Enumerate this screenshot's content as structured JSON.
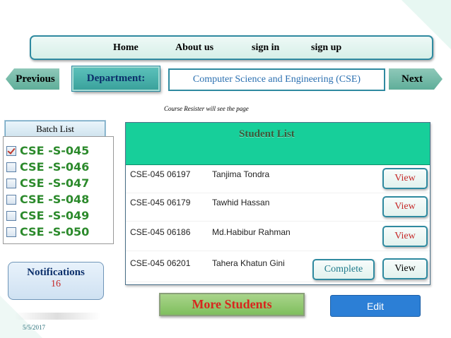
{
  "nav": {
    "home": "Home",
    "about": "About us",
    "signin": "sign in",
    "signup": "sign up"
  },
  "navigation": {
    "previous": "Previous",
    "next": "Next"
  },
  "department": {
    "label": "Department:",
    "value": "Computer Science and Engineering (CSE)"
  },
  "course_note": "Course Resister will see the page",
  "batch": {
    "title": "Batch List",
    "items": [
      {
        "label": "CSE -S-045",
        "checked": true
      },
      {
        "label": "CSE -S-046",
        "checked": false
      },
      {
        "label": "CSE -S-047",
        "checked": false
      },
      {
        "label": "CSE -S-048",
        "checked": false
      },
      {
        "label": "CSE -S-049",
        "checked": false
      },
      {
        "label": "CSE -S-050",
        "checked": false
      }
    ]
  },
  "student_list": {
    "title": "Student List",
    "rows": [
      {
        "id": "CSE-045 06197",
        "name": "Tanjima  Tondra",
        "action": "View"
      },
      {
        "id": "CSE-045 06179",
        "name": "Tawhid Hassan",
        "action": "View"
      },
      {
        "id": "CSE-045 06186",
        "name": "Md.Habibur Rahman",
        "action": "View"
      },
      {
        "id": "CSE-045 06201",
        "name": "Tahera Khatun Gini",
        "action": "View",
        "extra": "Complete"
      }
    ]
  },
  "notifications": {
    "label": "Notifications",
    "count": "16"
  },
  "buttons": {
    "more": "More  Students",
    "edit": "Edit"
  },
  "date": "5/5/2017",
  "colors": {
    "header_green": "#17cf9a",
    "batch_text": "#2c8a2c",
    "view_red": "#c62828",
    "edit_blue": "#2c7fd6",
    "border_teal": "#2f8aa0"
  }
}
